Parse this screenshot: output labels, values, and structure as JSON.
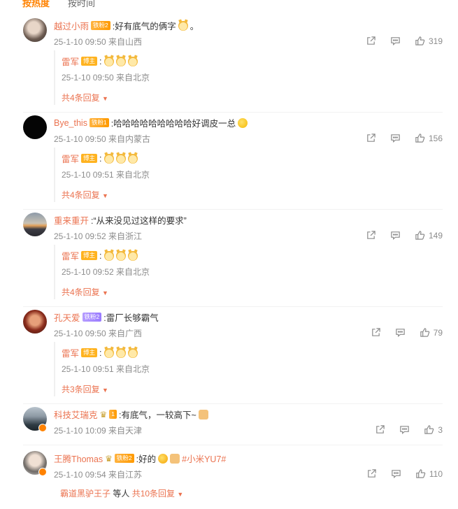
{
  "tabs": [
    "按热度",
    "按时间"
  ],
  "comments": [
    {
      "user": "越过小雨",
      "badge": "铁粉2",
      "text": ":好有底气的俩字",
      "text_suffix": "。",
      "meta": "25-1-10 09:50 来自山西",
      "likes": "319",
      "reply": {
        "user": "雷军",
        "badge": "博主",
        "meta": "25-1-10 09:50 来自北京",
        "more": "共4条回复"
      }
    },
    {
      "user": "Bye_this",
      "badge": "铁粉1",
      "text": ":哈哈哈哈哈哈哈哈哈好调皮一总",
      "meta": "25-1-10 09:50 来自内蒙古",
      "likes": "156",
      "reply": {
        "user": "雷军",
        "badge": "博主",
        "meta": "25-1-10 09:51 来自北京",
        "more": "共4条回复"
      }
    },
    {
      "user": "重来重开",
      "text": ":“从来没见过这样的要求”",
      "meta": "25-1-10 09:52 来自浙江",
      "likes": "149",
      "reply": {
        "user": "雷军",
        "badge": "博主",
        "meta": "25-1-10 09:52 来自北京",
        "more": "共4条回复"
      }
    },
    {
      "user": "孔天爱",
      "badge": "铁粉2",
      "text": ":雷厂长够霸气",
      "meta": "25-1-10 09:50 来自广西",
      "likes": "79",
      "reply": {
        "user": "雷军",
        "badge": "博主",
        "meta": "25-1-10 09:51 来自北京",
        "more": "共3条回复"
      }
    },
    {
      "user": "科技艾瑞克",
      "badge": "1",
      "text": ":有底气，一较高下~",
      "meta": "25-1-10 10:09 来自天津",
      "likes": "3"
    },
    {
      "user": "王腾Thomas",
      "badge": "铁粉2",
      "text": ":好的",
      "topic": "#小米YU7#",
      "meta": "25-1-10 09:54 来自江苏",
      "likes": "110",
      "more_user": "霸道黑驴王子",
      "more_mid": " 等人 ",
      "more": "共10条回复"
    }
  ],
  "colors": {
    "accent": "#ff8200",
    "username": "#eb7350",
    "meta": "#8c8c8c"
  }
}
